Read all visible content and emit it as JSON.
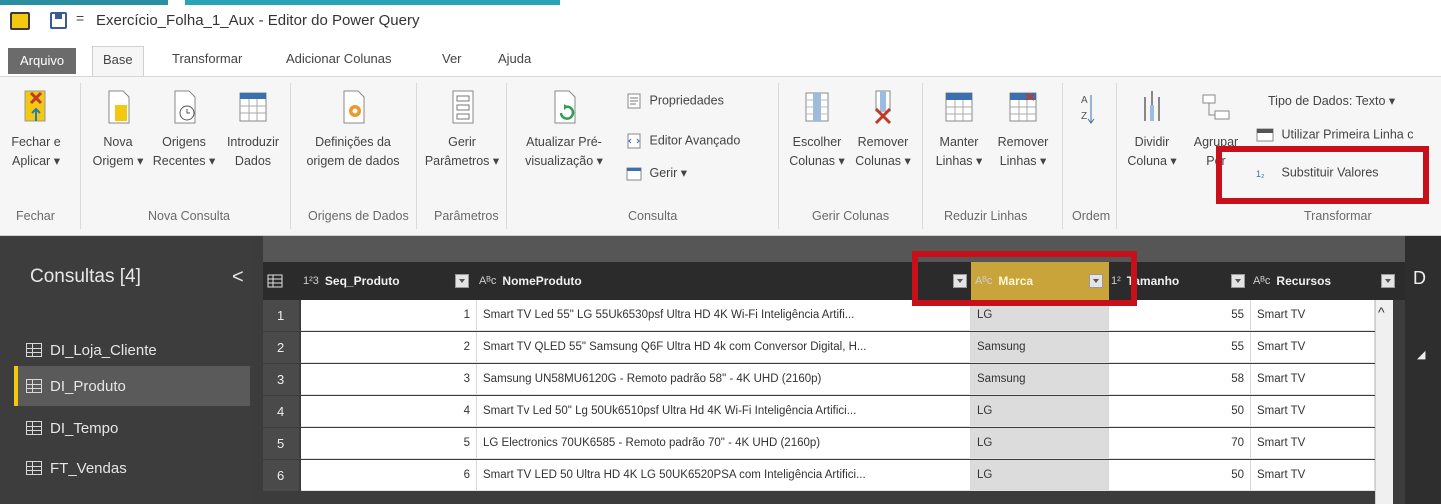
{
  "titlebar": {
    "quick_access": "=",
    "title": "Exercício_Folha_1_Aux - Editor do Power Query"
  },
  "tabs": [
    "Arquivo",
    "Base",
    "Transformar",
    "Adicionar Colunas",
    "Ver",
    "Ajuda"
  ],
  "ribbon": {
    "fechar": {
      "line1": "Fechar e",
      "line2": "Aplicar ▾",
      "group": "Fechar"
    },
    "nova_origem": {
      "line1": "Nova",
      "line2": "Origem ▾"
    },
    "origens_recentes": {
      "line1": "Origens",
      "line2": "Recentes ▾"
    },
    "introduzir_dados": {
      "line1": "Introduzir",
      "line2": "Dados"
    },
    "nova_consulta_group": "Nova Consulta",
    "definicoes": {
      "line1": "Definições da",
      "line2": "origem de dados"
    },
    "origens_group": "Origens de Dados",
    "gerir_parametros": {
      "line1": "Gerir",
      "line2": "Parâmetros ▾"
    },
    "parametros_group": "Parâmetros",
    "atualizar": {
      "line1": "Atualizar Pré-",
      "line2": "visualização ▾"
    },
    "propriedades": "Propriedades",
    "editor_avancado": "Editor Avançado",
    "gerir": "Gerir ▾",
    "consulta_group": "Consulta",
    "escolher_colunas": {
      "line1": "Escolher",
      "line2": "Colunas ▾"
    },
    "remover_colunas": {
      "line1": "Remover",
      "line2": "Colunas ▾"
    },
    "gerir_colunas_group": "Gerir Colunas",
    "manter_linhas": {
      "line1": "Manter",
      "line2": "Linhas ▾"
    },
    "remover_linhas": {
      "line1": "Remover",
      "line2": "Linhas ▾"
    },
    "reduzir_group": "Reduzir Linhas",
    "ordem_group": "Ordem",
    "dividir_coluna": {
      "line1": "Dividir",
      "line2": "Coluna ▾"
    },
    "agrupar_por": {
      "line1": "Agrupar",
      "line2": "Por"
    },
    "tipo_dados": "Tipo de Dados: Texto ▾",
    "primeira_linha": "Utilizar Primeira Linha c",
    "substituir_valores": "Substituir Valores",
    "transformar_group": "Transformar"
  },
  "queries": {
    "header": "Consultas [4]",
    "collapse": "<",
    "items": [
      "DI_Loja_Cliente",
      "DI_Produto",
      "DI_Tempo",
      "FT_Vendas"
    ],
    "selected": "DI_Produto"
  },
  "grid": {
    "columns": [
      {
        "type": "1²3",
        "name": "Seq_Produto"
      },
      {
        "type": "Aᴮc",
        "name": "NomeProduto"
      },
      {
        "type": "Aᴮc",
        "name": "Marca"
      },
      {
        "type": "1²",
        "name": "Tamanho"
      },
      {
        "type": "Aᴮc",
        "name": "Recursos"
      }
    ],
    "rows": [
      {
        "n": "1",
        "seq": "1",
        "nome": "Smart TV Led 55\" LG 55Uk6530psf Ultra HD 4K Wi-Fi Inteligência Artifi...",
        "marca": "LG",
        "tam": "55",
        "rec": "Smart TV"
      },
      {
        "n": "2",
        "seq": "2",
        "nome": "Smart TV QLED 55\" Samsung Q6F Ultra HD 4k com Conversor Digital, H...",
        "marca": "Samsung",
        "tam": "55",
        "rec": "Smart TV"
      },
      {
        "n": "3",
        "seq": "3",
        "nome": "Samsung UN58MU6120G - Remoto padrão 58\" - 4K UHD (2160p)",
        "marca": "Samsung",
        "tam": "58",
        "rec": "Smart TV"
      },
      {
        "n": "4",
        "seq": "4",
        "nome": "Smart Tv Led 50\" Lg 50Uk6510psf Ultra Hd 4K Wi-Fi Inteligência Artifici...",
        "marca": "LG",
        "tam": "50",
        "rec": "Smart TV"
      },
      {
        "n": "5",
        "seq": "5",
        "nome": "LG Electronics 70UK6585 - Remoto padrão 70\" - 4K UHD (2160p)",
        "marca": "LG",
        "tam": "70",
        "rec": "Smart TV"
      },
      {
        "n": "6",
        "seq": "6",
        "nome": "Smart TV LED 50 Ultra HD 4K LG 50UK6520PSA com Inteligência Artifici...",
        "marca": "LG",
        "tam": "50",
        "rec": "Smart TV"
      }
    ]
  },
  "right_pane": {
    "label": "D"
  },
  "colors": {
    "highlight": "#c8101b",
    "marca_header": "#c9a43a",
    "accent": "#f2c811"
  }
}
